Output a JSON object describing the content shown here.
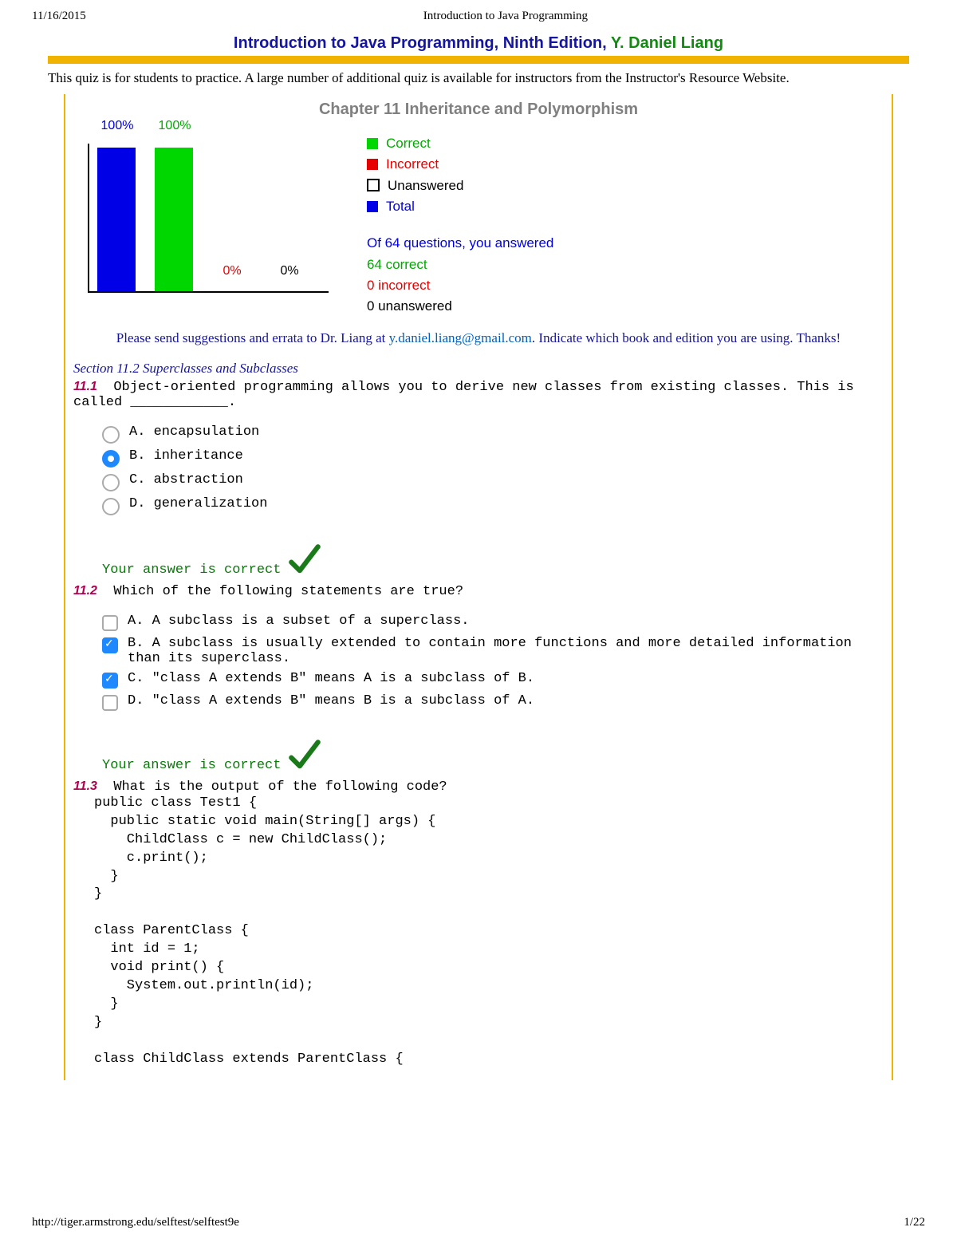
{
  "meta": {
    "date": "11/16/2015",
    "doc_title": "Introduction to Java Programming",
    "footer_url": "http://tiger.armstrong.edu/selftest/selftest9e",
    "page_indicator": "1/22"
  },
  "title": {
    "main": "Introduction to Java Programming, Ninth Edition, ",
    "author": "Y. Daniel Liang"
  },
  "intro": "This quiz is for students to practice. A large number of additional quiz is available for instructors from the Instructor's Resource Website.",
  "chapter": "Chapter 11 Inheritance and Polymorphism",
  "chart_data": {
    "type": "bar",
    "categories": [
      "Total",
      "Correct",
      "Incorrect",
      "Unanswered"
    ],
    "values": [
      100,
      100,
      0,
      0
    ],
    "labels": [
      "100%",
      "100%",
      "0%",
      "0%"
    ],
    "colors": [
      "#0000e6",
      "#00d600",
      "#e60000",
      "#ffffff"
    ],
    "ylim": [
      0,
      100
    ]
  },
  "legend": {
    "items": [
      {
        "color": "#00d600",
        "label": "Correct",
        "text_color": "#00aa00"
      },
      {
        "color": "#e60000",
        "label": "Incorrect",
        "text_color": "#e60000"
      },
      {
        "color": "outline",
        "label": "Unanswered",
        "text_color": "#000"
      },
      {
        "color": "#0000e6",
        "label": "Total",
        "text_color": "#0000e6"
      }
    ],
    "summary": {
      "line1": "Of 64 questions, you answered",
      "line2": "64 correct",
      "line3": "0 incorrect",
      "line4": "0 unanswered"
    }
  },
  "errata": {
    "pre": "Please send suggestions and errata to Dr. Liang at ",
    "email": "y.daniel.liang@gmail.com",
    "post": ". Indicate which book and edition you are using. Thanks!"
  },
  "section_title": "Section 11.2 Superclasses and Subclasses",
  "questions": {
    "q1": {
      "num": "11.1",
      "text": "Object-oriented programming allows you to derive new classes from existing classes. This is called ____________.",
      "options": [
        {
          "label": "A. encapsulation",
          "checked": false
        },
        {
          "label": "B. inheritance",
          "checked": true
        },
        {
          "label": "C. abstraction",
          "checked": false
        },
        {
          "label": "D. generalization",
          "checked": false
        }
      ],
      "feedback": "Your answer is correct"
    },
    "q2": {
      "num": "11.2",
      "text": "Which of the following statements are true?",
      "options": [
        {
          "label": "A. A subclass is a subset of a superclass.",
          "checked": false
        },
        {
          "label": "B. A subclass is usually extended to contain more functions and more detailed information than its superclass.",
          "checked": true
        },
        {
          "label": "C. \"class A extends B\" means A is a subclass of B.",
          "checked": true
        },
        {
          "label": "D. \"class A extends B\" means B is a subclass of A.",
          "checked": false
        }
      ],
      "feedback": "Your answer is correct"
    },
    "q3": {
      "num": "11.3",
      "text": "What is the output of the following code?",
      "code": "public class Test1 {\n  public static void main(String[] args) {\n    ChildClass c = new ChildClass();\n    c.print();\n  }\n}\n\nclass ParentClass {\n  int id = 1;\n  void print() {\n    System.out.println(id);\n  }\n}\n\nclass ChildClass extends ParentClass {"
    }
  }
}
